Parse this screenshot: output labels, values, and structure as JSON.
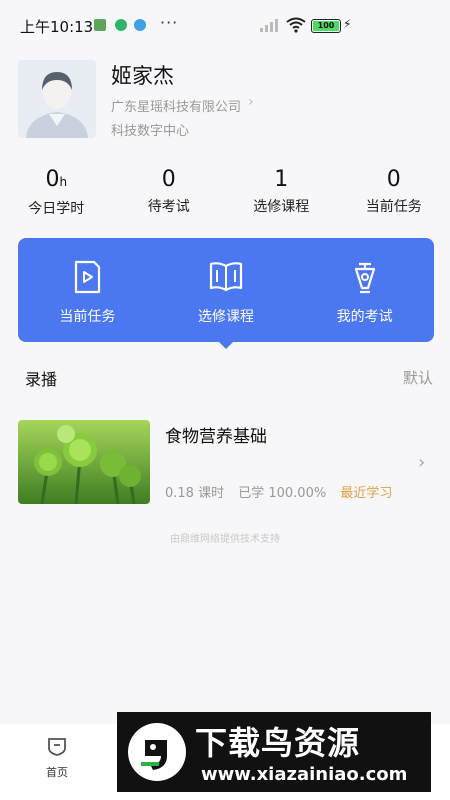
{
  "status_bar": {
    "time": "上午10:13",
    "more": "···",
    "battery": "100"
  },
  "profile": {
    "name": "姬家杰",
    "company": "广东星瑶科技有限公司",
    "department": "科技数字中心"
  },
  "stats": [
    {
      "value": "0",
      "unit": "h",
      "label": "今日学时"
    },
    {
      "value": "0",
      "unit": "",
      "label": "待考试"
    },
    {
      "value": "1",
      "unit": "",
      "label": "选修课程"
    },
    {
      "value": "0",
      "unit": "",
      "label": "当前任务"
    }
  ],
  "actions": [
    {
      "label": "当前任务",
      "icon": "play-document-icon"
    },
    {
      "label": "选修课程",
      "icon": "open-book-icon"
    },
    {
      "label": "我的考试",
      "icon": "pen-nib-icon"
    }
  ],
  "section": {
    "title": "录播",
    "sort": "默认"
  },
  "course": {
    "title": "食物营养基础",
    "hours": "0.18 课时",
    "progress": "已学 100.00%",
    "recent": "最近学习"
  },
  "support_text": "由鼎维网络提供技术支持",
  "tabbar": {
    "home_label": "首页"
  },
  "watermark": {
    "title": "下载鸟资源",
    "url": "www.xiazainiao.com"
  },
  "colors": {
    "accent": "#4b78f0",
    "recent": "#e0a246"
  }
}
